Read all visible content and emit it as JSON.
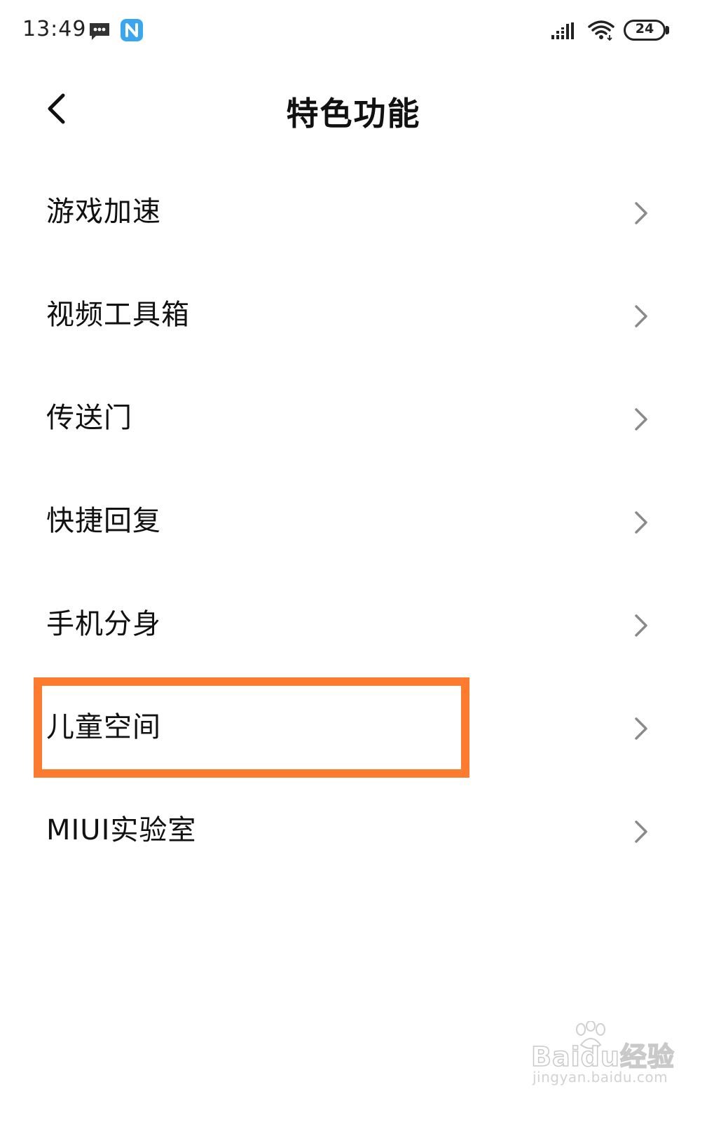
{
  "status_bar": {
    "time": "13:49",
    "battery_level": "24",
    "icons": [
      "message-icon",
      "nfc-icon",
      "signal-icon",
      "wifi-icon",
      "battery-icon"
    ]
  },
  "header": {
    "title": "特色功能",
    "back_icon": "chevron-left-icon"
  },
  "menu": {
    "items": [
      {
        "label": "游戏加速"
      },
      {
        "label": "视频工具箱"
      },
      {
        "label": "传送门"
      },
      {
        "label": "快捷回复"
      },
      {
        "label": "手机分身"
      },
      {
        "label": "儿童空间"
      },
      {
        "label": "MIUI实验室"
      }
    ],
    "item_icon": "chevron-right-icon",
    "highlighted_index": 5
  },
  "colors": {
    "highlight": "#fc7b2f",
    "nfc_badge": "#3aa6f0",
    "chevron": "#8a8a8a",
    "text": "#111111"
  },
  "watermark": {
    "brand": "Baidu经验",
    "domain": "jingyan.baidu.com"
  }
}
